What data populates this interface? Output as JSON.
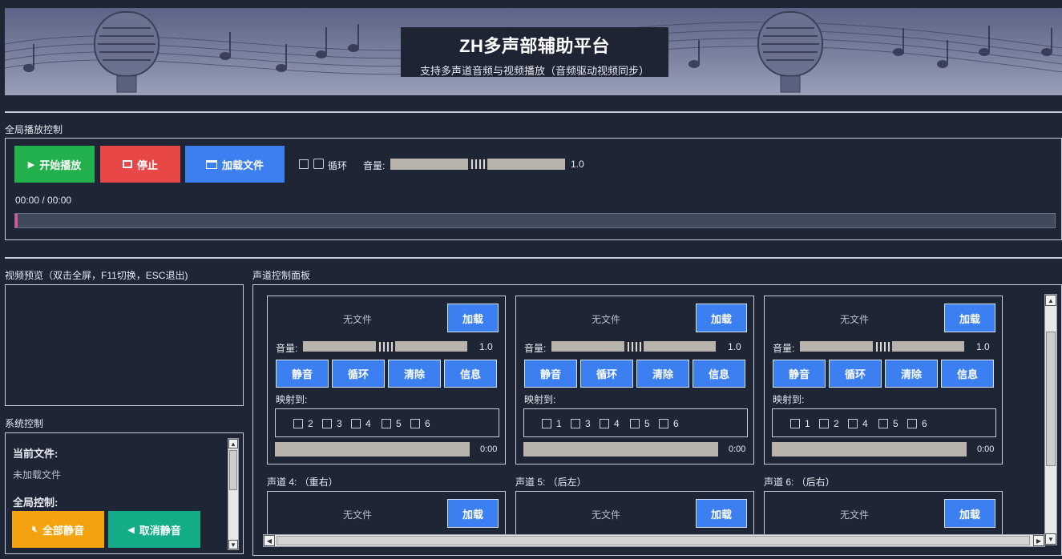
{
  "header": {
    "title": "ZH多声部辅助平台",
    "subtitle": "支持多声道音频与视频播放（音频驱动视频同步）"
  },
  "global": {
    "section_label": "全局播放控制",
    "play_label": "开始播放",
    "stop_label": "停止",
    "load_label": "加载文件",
    "loop_label": "循环",
    "volume_label": "音量:",
    "volume_value": "1.0",
    "volume_level": 0.5,
    "time_display": "00:00 / 00:00",
    "progress": 0.0
  },
  "video": {
    "section_label": "视频预览（双击全屏，F11切换，ESC退出)"
  },
  "system": {
    "section_label": "系统控制",
    "current_file_label": "当前文件:",
    "current_file_value": "未加载文件",
    "global_control_label": "全局控制:",
    "mute_all_label": "全部静音",
    "unmute_label": "取消静音"
  },
  "channels_panel": {
    "section_label": "声道控制面板",
    "channels": [
      {
        "title": "",
        "file": "无文件",
        "load": "加载",
        "vol_label": "音量:",
        "vol_value": "1.0",
        "vol_level": 0.5,
        "buttons": [
          "静音",
          "循环",
          "清除",
          "信息"
        ],
        "map_label": "映射到:",
        "map_options": [
          "2",
          "3",
          "4",
          "5",
          "6"
        ],
        "time": "0:00"
      },
      {
        "title": "",
        "file": "无文件",
        "load": "加载",
        "vol_label": "音量:",
        "vol_value": "1.0",
        "vol_level": 0.5,
        "buttons": [
          "静音",
          "循环",
          "清除",
          "信息"
        ],
        "map_label": "映射到:",
        "map_options": [
          "1",
          "3",
          "4",
          "5",
          "6"
        ],
        "time": "0:00"
      },
      {
        "title": "",
        "file": "无文件",
        "load": "加载",
        "vol_label": "音量:",
        "vol_value": "1.0",
        "vol_level": 0.5,
        "buttons": [
          "静音",
          "循环",
          "清除",
          "信息"
        ],
        "map_label": "映射到:",
        "map_options": [
          "1",
          "2",
          "4",
          "5",
          "6"
        ],
        "time": "0:00"
      },
      {
        "title": "声道 4: （重右）",
        "file": "无文件",
        "load": "加载"
      },
      {
        "title": "声道 5: （后左）",
        "file": "无文件",
        "load": "加载"
      },
      {
        "title": "声道 6: （后右）",
        "file": "无文件",
        "load": "加载"
      }
    ]
  },
  "colors": {
    "background": "#1e2535",
    "play": "#22b14c",
    "stop": "#e84747",
    "accent": "#3b7ff0",
    "mute": "#f5a20f",
    "unmute": "#13ad88"
  }
}
